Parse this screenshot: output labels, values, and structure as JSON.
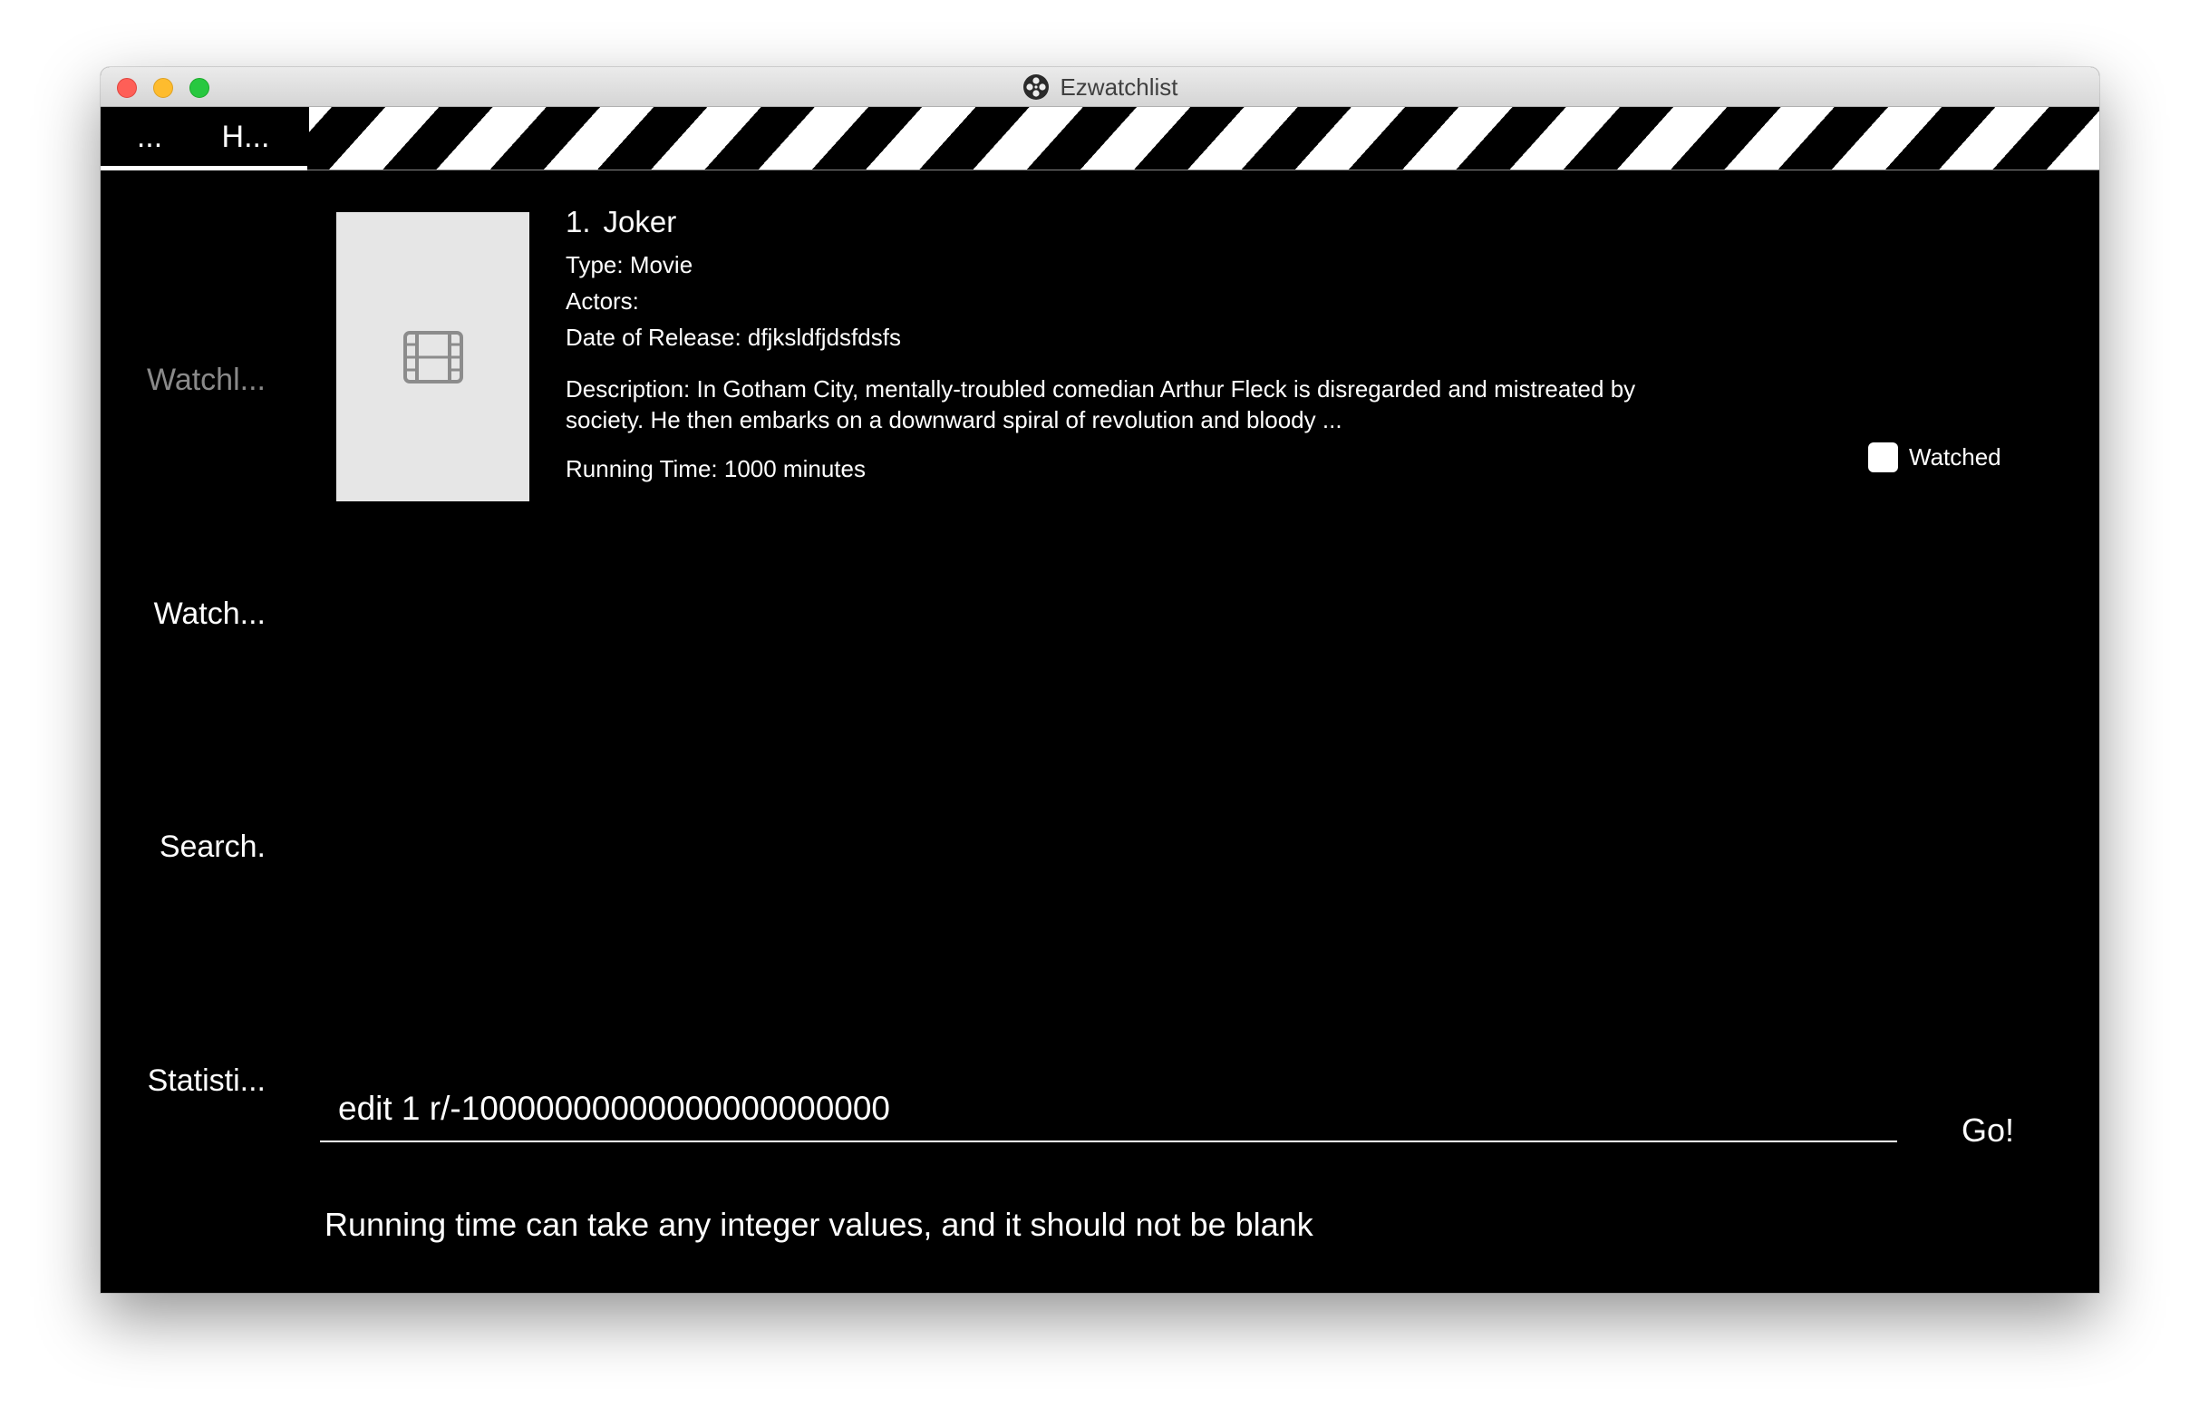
{
  "window": {
    "title": "Ezwatchlist"
  },
  "tabs": [
    {
      "label": "..."
    },
    {
      "label": "H..."
    }
  ],
  "sidebar": {
    "items": [
      {
        "label": "Watchl..."
      },
      {
        "label": "Watch..."
      },
      {
        "label": "Search."
      },
      {
        "label": "Statisti..."
      }
    ]
  },
  "card": {
    "index": "1.",
    "title": "Joker",
    "type": "Type: Movie",
    "actors": "Actors:",
    "date": "Date of Release: dfjksldfjdsfdsfs",
    "description": "Description: In Gotham City, mentally-troubled comedian Arthur Fleck is disregarded and mistreated by society. He then embarks on a downward spiral of revolution and bloody ...",
    "running_time": "Running Time: 1000 minutes",
    "watched_label": "Watched",
    "watched": false
  },
  "command": {
    "value": "edit 1 r/-10000000000000000000000",
    "go_label": "Go!"
  },
  "feedback": "Running time can take any integer values, and it should not be blank"
}
